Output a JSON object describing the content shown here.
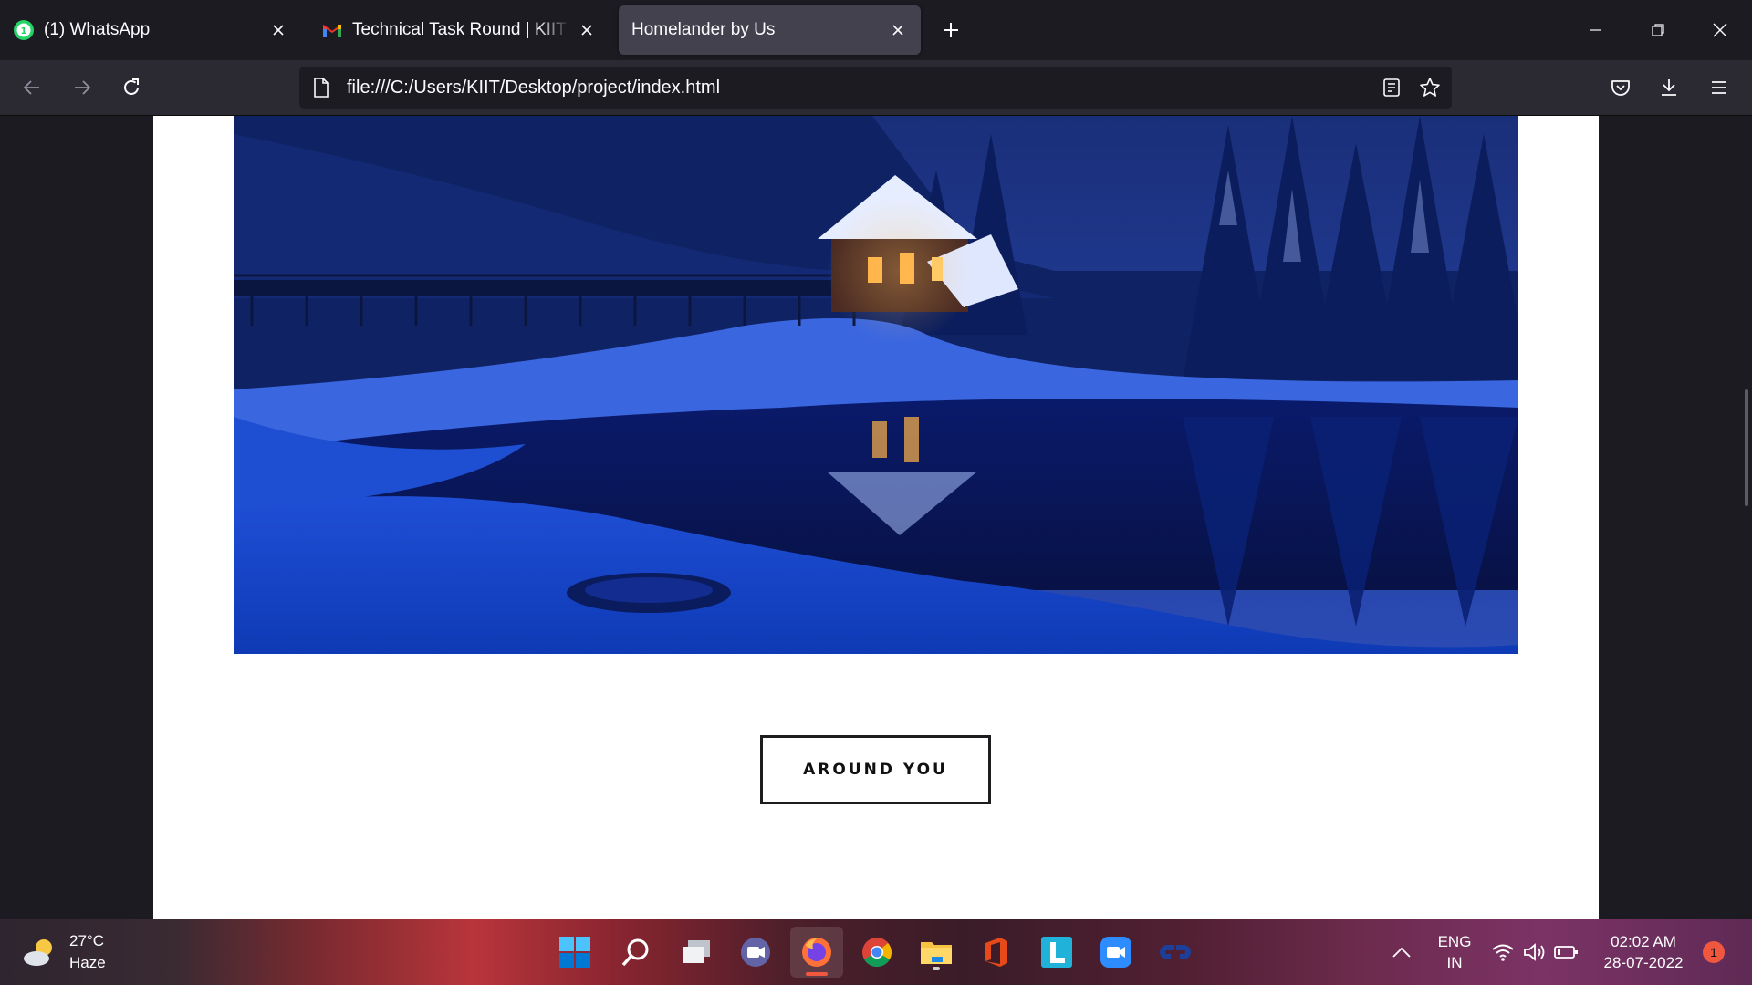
{
  "browser": {
    "tabs": [
      {
        "title": "(1) WhatsApp",
        "icon": "whatsapp-icon",
        "active": false
      },
      {
        "title": "Technical Task Round | KIIT Univ",
        "icon": "gmail-icon",
        "active": false
      },
      {
        "title": "Homelander by Us",
        "icon": "",
        "active": true
      }
    ],
    "url": "file:///C:/Users/KIIT/Desktop/project/index.html"
  },
  "page": {
    "hero_image": "snowy-cabin-lake-night-photo",
    "button_label": "AROUND YOU"
  },
  "taskbar": {
    "weather": {
      "temp": "27°C",
      "condition": "Haze"
    },
    "language": {
      "code": "ENG",
      "region": "IN"
    },
    "clock": {
      "time": "02:02 AM",
      "date": "28-07-2022"
    },
    "notifications": "1"
  },
  "colors": {
    "chrome_dark": "#1c1b22",
    "toolbar": "#2b2a33",
    "active_tab": "#42414d",
    "page_bg": "#ffffff",
    "button_border": "#1d1d1f"
  }
}
